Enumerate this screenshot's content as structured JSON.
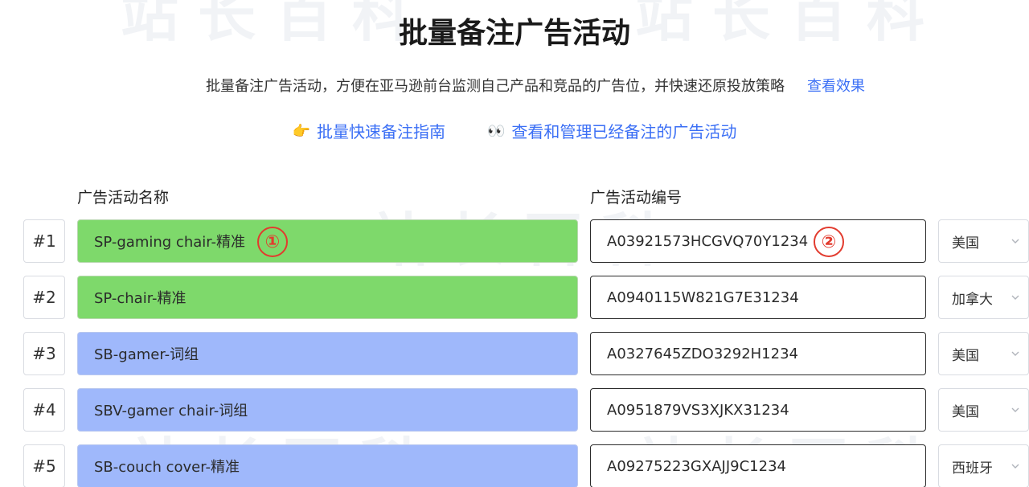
{
  "page": {
    "title": "批量备注广告活动",
    "subtitle": "批量备注广告活动，方便在亚马逊前台监测自己产品和竞品的广告位，并快速还原投放策略",
    "view_effect_link": "查看效果"
  },
  "guides": [
    {
      "icon": "👉",
      "label": "批量快速备注指南"
    },
    {
      "icon": "👀",
      "label": "查看和管理已经备注的广告活动"
    }
  ],
  "columns": {
    "name_header": "广告活动名称",
    "id_header": "广告活动编号"
  },
  "rows": [
    {
      "index": "#1",
      "name": "SP-gaming chair-精准",
      "name_color": "green",
      "id": "A03921573HCGVQ70Y1234",
      "country": "美国"
    },
    {
      "index": "#2",
      "name": "SP-chair-精准",
      "name_color": "green",
      "id": "A0940115W821G7E31234",
      "country": "加拿大"
    },
    {
      "index": "#3",
      "name": "SB-gamer-词组",
      "name_color": "blue",
      "id": "A0327645ZDO3292H1234",
      "country": "美国"
    },
    {
      "index": "#4",
      "name": "SBV-gamer chair-词组",
      "name_color": "blue",
      "id": "A0951879VS3XJKX31234",
      "country": "美国"
    },
    {
      "index": "#5",
      "name": "SB-couch cover-精准",
      "name_color": "blue",
      "id": "A09275223GXAJJ9C1234",
      "country": "西班牙"
    }
  ],
  "markers": [
    "①",
    "②"
  ],
  "colors": {
    "accent_link": "#3b6ff5",
    "green_cell": "#7ed96b",
    "blue_cell": "#9fb8fb",
    "marker_red": "#e23b2e"
  }
}
